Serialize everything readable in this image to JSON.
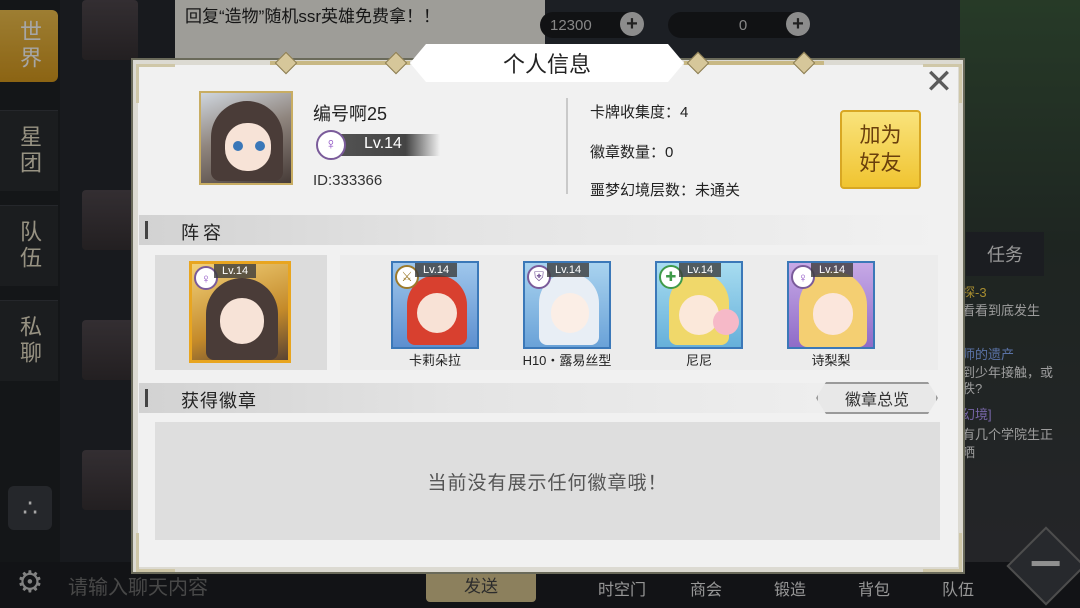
{
  "background": {
    "sidebar_tabs": [
      "世界",
      "星团",
      "队伍",
      "私聊"
    ],
    "chat_message": "回复“造物”随机ssr英雄免费拿！！",
    "currency_1": "12300",
    "currency_2": "0",
    "task_tab": "任务",
    "right_texts": [
      "探-3",
      "看看到底发生",
      "师的遗产",
      "到少年接触，或",
      "秩?",
      "幻境]",
      "有几个学院生正",
      "晒"
    ],
    "chat_input_placeholder": "请输入聊天内容",
    "send_label": "发送",
    "bottom_nav": [
      "时空门",
      "商会",
      "锻造",
      "背包",
      "队伍"
    ]
  },
  "modal": {
    "title": "个人信息",
    "close_glyph": "✕",
    "player": {
      "name": "编号啊25",
      "level": "Lv.14",
      "id": "ID:333366"
    },
    "stats": [
      {
        "label": "卡牌收集度：",
        "value": "4"
      },
      {
        "label": "徽章数量：",
        "value": "0"
      },
      {
        "label": "噩梦幻境层数：",
        "value": "未通关"
      }
    ],
    "add_friend_label": "加为\n好友",
    "lineup": {
      "header": "阵容",
      "leader": {
        "level": "Lv.14",
        "class_icon": "female-symbol-icon"
      },
      "members": [
        {
          "name": "卡莉朵拉",
          "level": "Lv.14",
          "class_icon": "sword-icon",
          "color": "#e0473a"
        },
        {
          "name": "H10・露易丝型",
          "level": "Lv.14",
          "class_icon": "shield-icon",
          "color": "#dfe7f1"
        },
        {
          "name": "尼尼",
          "level": "Lv.14",
          "class_icon": "cross-icon",
          "color": "#f1dd7b"
        },
        {
          "name": "诗梨梨",
          "level": "Lv.14",
          "class_icon": "female-symbol-icon",
          "color": "#f4d27c"
        }
      ]
    },
    "badges": {
      "header": "获得徽章",
      "overview_label": "徽章总览",
      "empty_text": "当前没有展示任何徽章哦！"
    }
  }
}
